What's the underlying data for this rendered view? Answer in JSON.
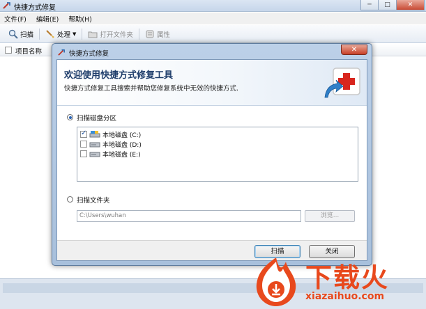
{
  "main_window": {
    "title": "快捷方式修复",
    "caption": {
      "minimize": "─",
      "maximize": "□",
      "close": "✕"
    },
    "menu": [
      {
        "label": "文件(F)"
      },
      {
        "label": "编辑(E)"
      },
      {
        "label": "帮助(H)"
      }
    ],
    "toolbar": {
      "scan": "扫描",
      "process": "处理",
      "open_folder": "打开文件夹",
      "properties": "属性"
    },
    "list_header": {
      "item_name": "项目名称"
    }
  },
  "dialog": {
    "title": "快捷方式修复",
    "close": "✕",
    "banner": {
      "title": "欢迎使用快捷方式修复工具",
      "subtitle": "快捷方式修复工具搜索并帮助您修复系统中无效的快捷方式."
    },
    "scan_drive_label": "扫描磁盘分区",
    "drives": [
      {
        "label": "本地磁盘 (C:)",
        "checked": true
      },
      {
        "label": "本地磁盘 (D:)",
        "checked": false
      },
      {
        "label": "本地磁盘 (E:)",
        "checked": false
      }
    ],
    "scan_folder_label": "扫描文件夹",
    "folder_path": "C:\\Users\\wuhan",
    "browse_label": "浏览...",
    "scan_button": "扫描",
    "close_button": "关闭"
  },
  "watermark": {
    "brand": "下载火",
    "url": "xiazaihuo.com"
  },
  "colors": {
    "dialog_frame": "#bcd0e8",
    "banner_title": "#1d3c6a",
    "watermark": "#e8491d",
    "close_red": "#c73f27"
  }
}
